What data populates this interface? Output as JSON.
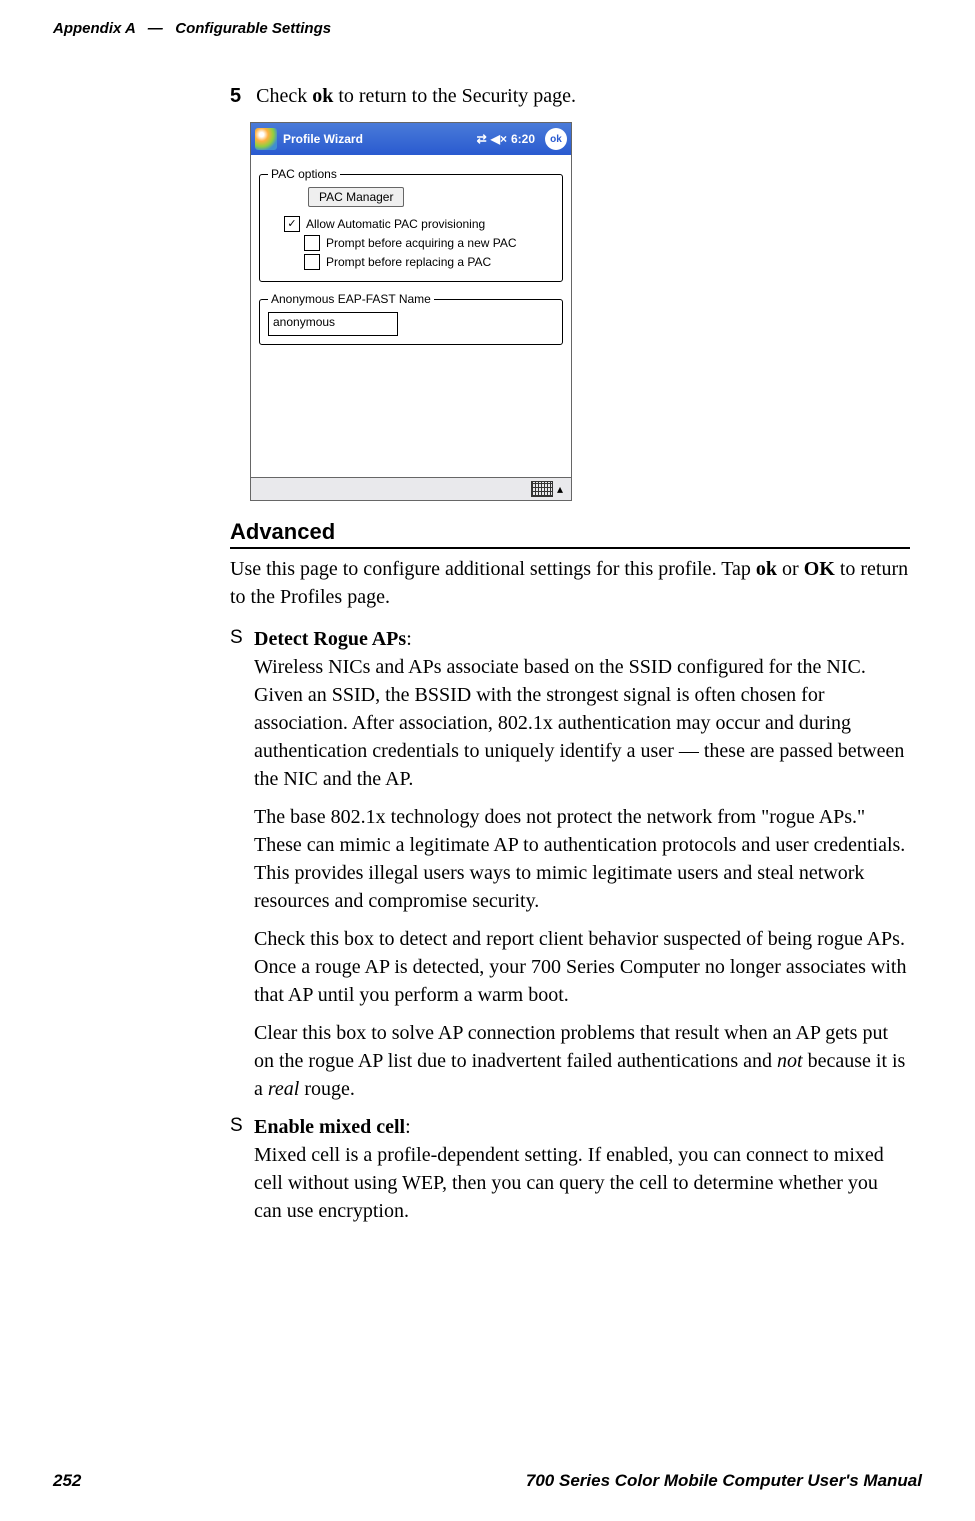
{
  "header": {
    "appendix_label": "Appendix A",
    "dash": "—",
    "section_title": "Configurable Settings"
  },
  "step": {
    "number": "5",
    "text_parts": [
      "Check ",
      "ok",
      " to return to the Security page."
    ]
  },
  "screenshot": {
    "title": "Profile Wizard",
    "clock": "6:20",
    "ok_badge": "ok",
    "pac_options": {
      "legend": "PAC options",
      "manager_button": "PAC Manager",
      "allow_auto": "Allow Automatic PAC provisioning",
      "prompt_acquire": "Prompt before acquiring a new PAC",
      "prompt_replace": "Prompt before replacing a PAC"
    },
    "anon": {
      "legend": "Anonymous EAP-FAST Name",
      "value": "anonymous"
    }
  },
  "advanced": {
    "heading": "Advanced",
    "intro_parts": [
      "Use this page to configure additional settings for this profile. Tap ",
      "ok",
      " or ",
      "OK",
      " to return to the Profiles page."
    ],
    "detect": {
      "title": "Detect Rogue APs",
      "p1": "Wireless NICs and APs associate based on the SSID configured for the NIC. Given an SSID, the BSSID with the strongest signal is often chosen for association. After association, 802.1x authentication may occur and during authentication credentials to uniquely identify a user — these are passed between the NIC and the AP.",
      "p2": "The base 802.1x technology does not protect the network from \"rogue APs.\" These can mimic a legitimate AP to authentication protocols and user credentials. This provides illegal users ways to mimic legitimate users and steal network resources and compromise security.",
      "p3": "Check this box to detect and report client behavior suspected of being rogue APs. Once a rouge AP is detected, your 700 Series Computer no longer associates with that AP until you perform a warm boot.",
      "p4_parts": [
        "Clear this box to solve AP connection problems that result when an AP gets put on the rogue AP list due to inadvertent failed authentications and ",
        "not",
        " because it is a ",
        "real",
        " rouge."
      ]
    },
    "mixed": {
      "title": "Enable mixed cell",
      "p1": "Mixed cell is a profile-dependent setting. If enabled, you can connect to mixed cell without using WEP, then you can query the cell to determine whether you can use encryption."
    }
  },
  "footer": {
    "page_num": "252",
    "manual_title": "700 Series Color Mobile Computer User's Manual"
  }
}
